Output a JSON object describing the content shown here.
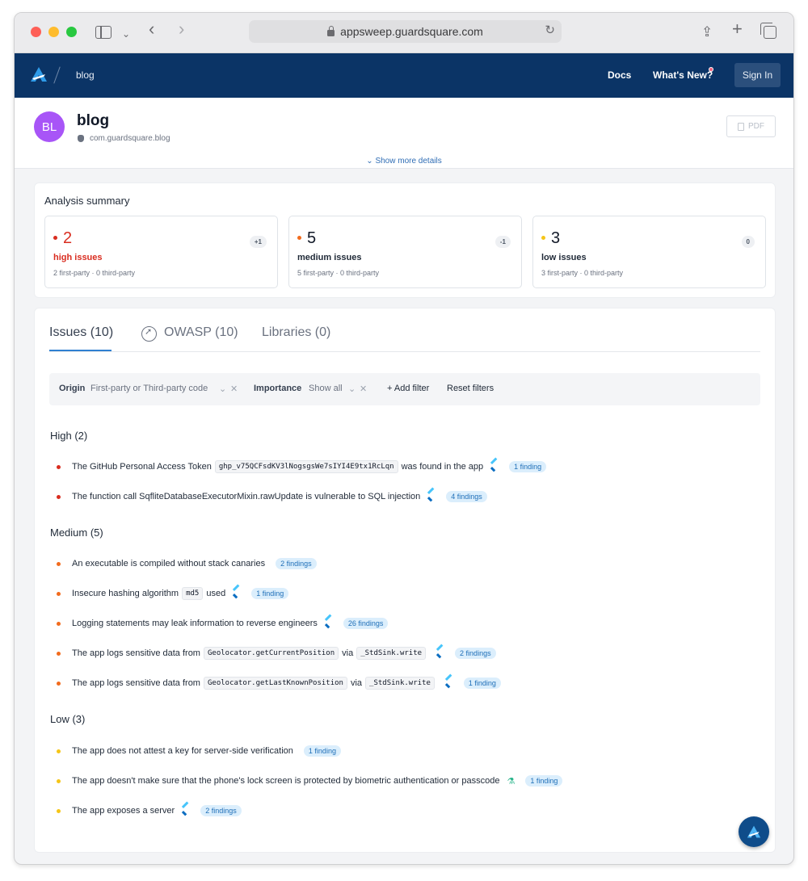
{
  "browser": {
    "url": "appsweep.guardsquare.com"
  },
  "appbar": {
    "breadcrumb": "blog",
    "nav_docs": "Docs",
    "nav_whats_new": "What's New?",
    "sign_in": "Sign In"
  },
  "app": {
    "avatar": "BL",
    "name": "blog",
    "bundle_id": "com.guardsquare.blog",
    "pdf_label": "PDF",
    "show_more": "Show more details"
  },
  "summary": {
    "title": "Analysis summary",
    "stats": [
      {
        "count": "2",
        "delta": "+1",
        "label": "high issues",
        "sub": "2 first-party  ·  0 third-party",
        "color": "#d92d20"
      },
      {
        "count": "5",
        "delta": "-1",
        "label": "medium issues",
        "sub": "5 first-party  ·  0 third-party",
        "color": "#f26b1d"
      },
      {
        "count": "3",
        "delta": "0",
        "label": "low issues",
        "sub": "3 first-party  ·  0 third-party",
        "color": "#f5c518"
      }
    ]
  },
  "tabs": {
    "issues": "Issues (10)",
    "owasp": "OWASP (10)",
    "libraries": "Libraries (0)"
  },
  "filters": {
    "origin_key": "Origin",
    "origin_value": "First-party or Third-party code",
    "importance_key": "Importance",
    "importance_value": "Show all",
    "add_filter": "+  Add filter",
    "reset_filters": "Reset filters"
  },
  "groups": {
    "high": {
      "title": "High (2)",
      "items": [
        {
          "text": "The GitHub Personal Access Token",
          "code": "ghp_v75QCFsdKV3lNogsgsWe7sIYI4E9tx1RcLqn",
          "text2": "was found in the app",
          "badge": "1 finding"
        },
        {
          "text": "The function call SqfliteDatabaseExecutorMixin.rawUpdate is vulnerable to SQL injection",
          "badge": "4 findings"
        }
      ]
    },
    "medium": {
      "title": "Medium (5)",
      "items": [
        {
          "text": "An executable is compiled without stack canaries",
          "badge": "2 findings"
        },
        {
          "text": "Insecure hashing algorithm",
          "code": "md5",
          "text2": "used",
          "badge": "1 finding"
        },
        {
          "text": "Logging statements may leak information to reverse engineers",
          "badge": "26 findings"
        },
        {
          "text": "The app logs sensitive data from",
          "code": "Geolocator.getCurrentPosition",
          "text2": "via",
          "code2": "_StdSink.write",
          "badge": "2 findings"
        },
        {
          "text": "The app logs sensitive data from",
          "code": "Geolocator.getLastKnownPosition",
          "text2": "via",
          "code2": "_StdSink.write",
          "badge": "1 finding"
        }
      ]
    },
    "low": {
      "title": "Low (3)",
      "items": [
        {
          "text": "The app does not attest a key for server-side verification",
          "badge": "1 finding"
        },
        {
          "text": "The app doesn't make sure that the phone's lock screen is protected by biometric authentication or passcode",
          "badge": "1 finding"
        },
        {
          "text": "The app exposes a server",
          "badge": "2 findings"
        }
      ]
    }
  },
  "icons": {
    "flutter": "flutter-icon",
    "flask": "flask-icon"
  }
}
